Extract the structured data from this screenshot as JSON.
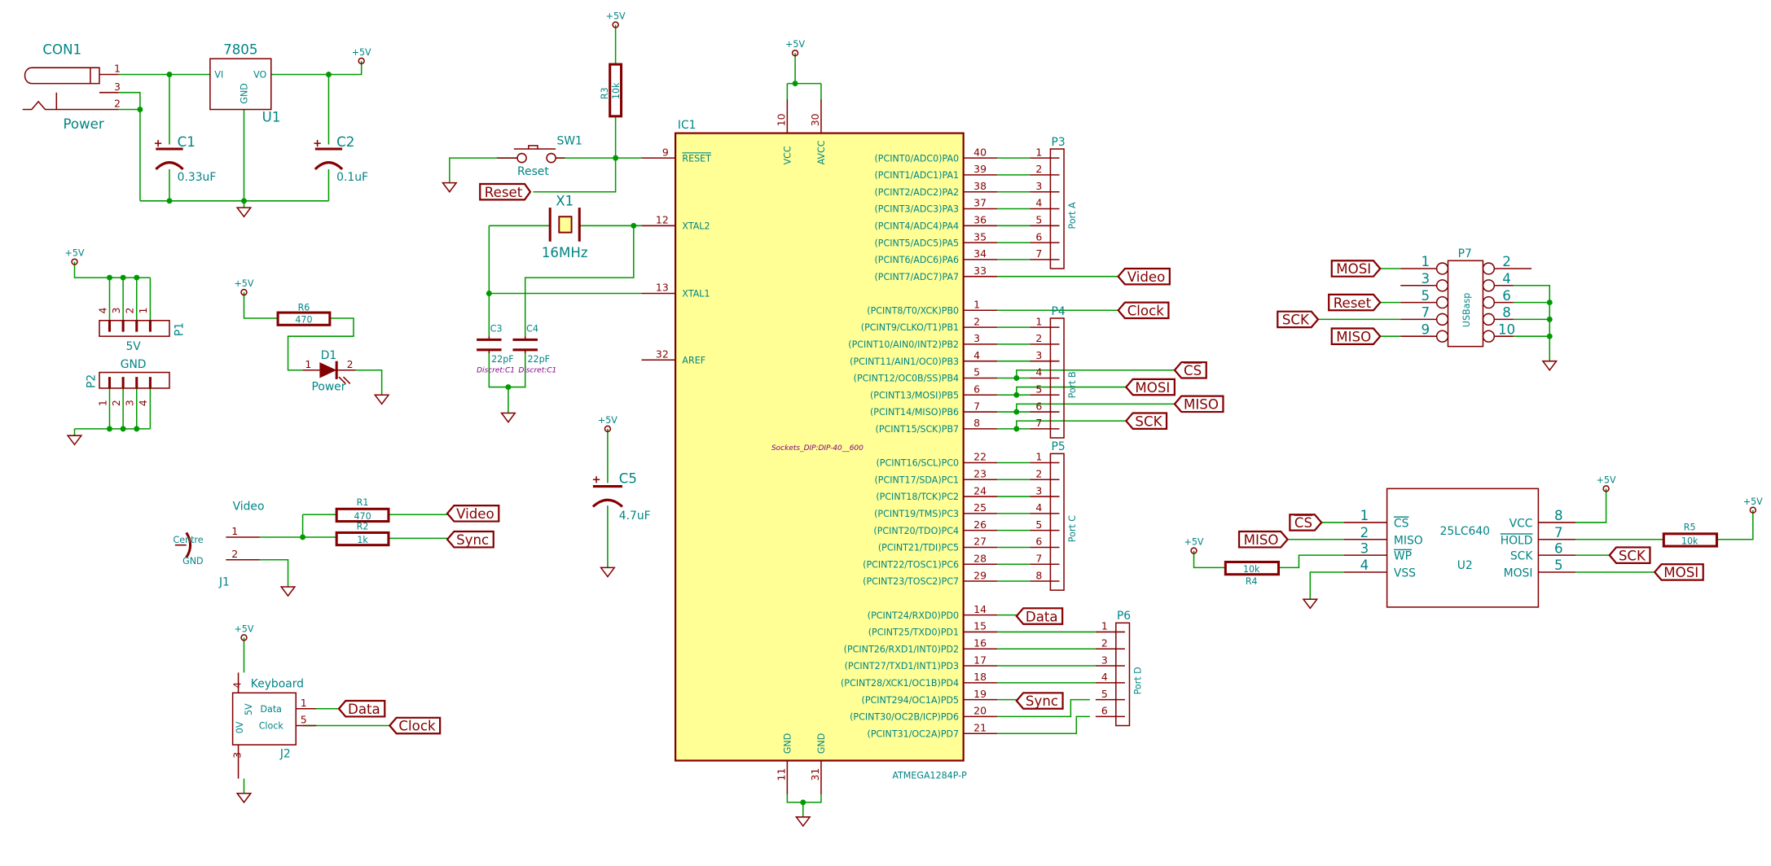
{
  "colors": {
    "wire": "#009900",
    "component": "#840000",
    "text": "#008484",
    "ic_fill": "#ffff96",
    "footprint": "#840084"
  },
  "power": {
    "vcc": "+5V"
  },
  "con1": {
    "ref": "CON1",
    "value": "Power",
    "pins": [
      "1",
      "3",
      "2"
    ]
  },
  "u1": {
    "ref": "U1",
    "value": "7805",
    "vi": "VI",
    "vo": "VO",
    "gnd": "GND"
  },
  "c1": {
    "ref": "C1",
    "value": "0.33uF"
  },
  "c2": {
    "ref": "C2",
    "value": "0.1uF"
  },
  "p1": {
    "ref": "P1",
    "value": "5V",
    "pins": [
      "4",
      "3",
      "2",
      "1"
    ]
  },
  "p2": {
    "ref": "P2",
    "value": "GND",
    "pins": [
      "1",
      "2",
      "3",
      "4"
    ]
  },
  "r6": {
    "ref": "R6",
    "value": "470"
  },
  "d1": {
    "ref": "D1",
    "value": "Power",
    "pin1": "1",
    "pin2": "2"
  },
  "r3": {
    "ref": "R3",
    "value": "10k"
  },
  "sw1": {
    "ref": "SW1",
    "value": "Reset"
  },
  "x1": {
    "ref": "X1",
    "value": "16MHz"
  },
  "c3": {
    "ref": "C3",
    "value": "22pF",
    "footprint": "Discret:C1"
  },
  "c4": {
    "ref": "C4",
    "value": "22pF",
    "footprint": "Discret:C1"
  },
  "c5": {
    "ref": "C5",
    "value": "4.7uF"
  },
  "j1": {
    "ref": "J1",
    "value": "Video",
    "centre": "Centre",
    "gnd": "GND",
    "pin1": "1",
    "pin2": "2"
  },
  "r1": {
    "ref": "R1",
    "value": "470"
  },
  "r2": {
    "ref": "R2",
    "value": "1k"
  },
  "j2": {
    "ref": "J2",
    "value": "Keyboard",
    "data": "Data",
    "clock": "Clock",
    "v5": "5V",
    "v0": "0V",
    "pin1": "1",
    "pin5": "5",
    "pin4": "4",
    "pin3": "3"
  },
  "ic1": {
    "ref": "IC1",
    "value": "ATMEGA1284P-P",
    "footprint": "Sockets_DIP:DIP-40__600",
    "top_pins": [
      {
        "num": "10",
        "name": "VCC"
      },
      {
        "num": "30",
        "name": "AVCC"
      }
    ],
    "bottom_pins": [
      {
        "num": "11",
        "name": "GND"
      },
      {
        "num": "31",
        "name": "GND"
      }
    ],
    "left_pins": [
      {
        "num": "9",
        "name": "RESET"
      },
      {
        "num": "12",
        "name": "XTAL2"
      },
      {
        "num": "13",
        "name": "XTAL1"
      },
      {
        "num": "32",
        "name": "AREF"
      }
    ],
    "port_a": [
      {
        "num": "40",
        "name": "(PCINT0/ADC0)PA0"
      },
      {
        "num": "39",
        "name": "(PCINT1/ADC1)PA1"
      },
      {
        "num": "38",
        "name": "(PCINT2/ADC2)PA2"
      },
      {
        "num": "37",
        "name": "(PCINT3/ADC3)PA3"
      },
      {
        "num": "36",
        "name": "(PCINT4/ADC4)PA4"
      },
      {
        "num": "35",
        "name": "(PCINT5/ADC5)PA5"
      },
      {
        "num": "34",
        "name": "(PCINT6/ADC6)PA6"
      },
      {
        "num": "33",
        "name": "(PCINT7/ADC7)PA7"
      }
    ],
    "port_b": [
      {
        "num": "1",
        "name": "(PCINT8/T0/XCK)PB0"
      },
      {
        "num": "2",
        "name": "(PCINT9/CLKO/T1)PB1"
      },
      {
        "num": "3",
        "name": "(PCINT10/AIN0/INT2)PB2"
      },
      {
        "num": "4",
        "name": "(PCINT11/AIN1/OC0)PB3"
      },
      {
        "num": "5",
        "name": "(PCINT12/OC0B/SS)PB4"
      },
      {
        "num": "6",
        "name": "(PCINT13/MOSI)PB5"
      },
      {
        "num": "7",
        "name": "(PCINT14/MISO)PB6"
      },
      {
        "num": "8",
        "name": "(PCINT15/SCK)PB7"
      }
    ],
    "port_c": [
      {
        "num": "22",
        "name": "(PCINT16/SCL)PC0"
      },
      {
        "num": "23",
        "name": "(PCINT17/SDA)PC1"
      },
      {
        "num": "24",
        "name": "(PCINT18/TCK)PC2"
      },
      {
        "num": "25",
        "name": "(PCINT19/TMS)PC3"
      },
      {
        "num": "26",
        "name": "(PCINT20/TDO)PC4"
      },
      {
        "num": "27",
        "name": "(PCINT21/TDI)PC5"
      },
      {
        "num": "28",
        "name": "(PCINT22/TOSC1)PC6"
      },
      {
        "num": "29",
        "name": "(PCINT23/TOSC2)PC7"
      }
    ],
    "port_d": [
      {
        "num": "14",
        "name": "(PCINT24/RXD0)PD0"
      },
      {
        "num": "15",
        "name": "(PCINT25/TXD0)PD1"
      },
      {
        "num": "16",
        "name": "(PCINT26/RXD1/INT0)PD2"
      },
      {
        "num": "17",
        "name": "(PCINT27/TXD1/INT1)PD3"
      },
      {
        "num": "18",
        "name": "(PCINT28/XCK1/OC1B)PD4"
      },
      {
        "num": "19",
        "name": "(PCINT294/OC1A)PD5"
      },
      {
        "num": "20",
        "name": "(PCINT30/OC2B/ICP)PD6"
      },
      {
        "num": "21",
        "name": "(PCINT31/OC2A)PD7"
      }
    ]
  },
  "p3": {
    "ref": "P3",
    "value": "Port A",
    "pins": [
      "1",
      "2",
      "3",
      "4",
      "5",
      "6",
      "7"
    ]
  },
  "p4": {
    "ref": "P4",
    "value": "Port B",
    "pins": [
      "1",
      "2",
      "3",
      "4",
      "5",
      "6",
      "7"
    ]
  },
  "p5": {
    "ref": "P5",
    "value": "Port C",
    "pins": [
      "1",
      "2",
      "3",
      "4",
      "5",
      "6",
      "7",
      "8"
    ]
  },
  "p6": {
    "ref": "P6",
    "value": "Port D",
    "pins": [
      "1",
      "2",
      "3",
      "4",
      "5",
      "6"
    ]
  },
  "p7": {
    "ref": "P7",
    "value": "USBasp",
    "left_pins": [
      "1",
      "3",
      "5",
      "7",
      "9"
    ],
    "right_pins": [
      "2",
      "4",
      "6",
      "8",
      "10"
    ]
  },
  "u2": {
    "ref": "U2",
    "value": "25LC640",
    "left_pins": [
      {
        "num": "1",
        "name": "CS"
      },
      {
        "num": "2",
        "name": "MISO"
      },
      {
        "num": "3",
        "name": "WP"
      },
      {
        "num": "4",
        "name": "VSS"
      }
    ],
    "right_pins": [
      {
        "num": "8",
        "name": "VCC"
      },
      {
        "num": "7",
        "name": "HOLD"
      },
      {
        "num": "6",
        "name": "SCK"
      },
      {
        "num": "5",
        "name": "MOSI"
      }
    ]
  },
  "r4": {
    "ref": "R4",
    "value": "10k"
  },
  "r5": {
    "ref": "R5",
    "value": "10k"
  },
  "labels": {
    "reset": "Reset",
    "video": "Video",
    "clock": "Clock",
    "cs": "CS",
    "mosi": "MOSI",
    "miso": "MISO",
    "sck": "SCK",
    "data": "Data",
    "sync": "Sync"
  }
}
